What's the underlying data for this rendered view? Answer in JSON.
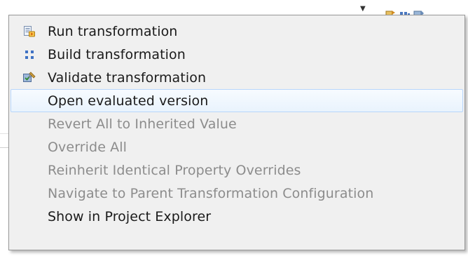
{
  "menu": {
    "items": [
      {
        "label": "Run transformation",
        "icon": "run-transformation-icon",
        "enabled": true
      },
      {
        "label": "Build transformation",
        "icon": "build-transformation-icon",
        "enabled": true
      },
      {
        "label": "Validate transformation",
        "icon": "validate-transformation-icon",
        "enabled": true
      },
      {
        "label": "Open evaluated version",
        "icon": "",
        "enabled": true,
        "highlighted": true
      },
      {
        "label": "Revert All to Inherited Value",
        "icon": "",
        "enabled": false
      },
      {
        "label": "Override All",
        "icon": "",
        "enabled": false
      },
      {
        "label": "Reinherit Identical Property Overrides",
        "icon": "",
        "enabled": false
      },
      {
        "label": "Navigate to Parent Transformation Configuration",
        "icon": "",
        "enabled": false
      },
      {
        "label": "Show in Project Explorer",
        "icon": "",
        "enabled": true
      }
    ]
  },
  "colors": {
    "menu_background": "#f0f0f0",
    "menu_border": "#979797",
    "highlight_fill": "#e9f3fd",
    "highlight_border": "#b8d6fb",
    "enabled_text": "#1a1a1a",
    "disabled_text": "#8c8c8c"
  }
}
